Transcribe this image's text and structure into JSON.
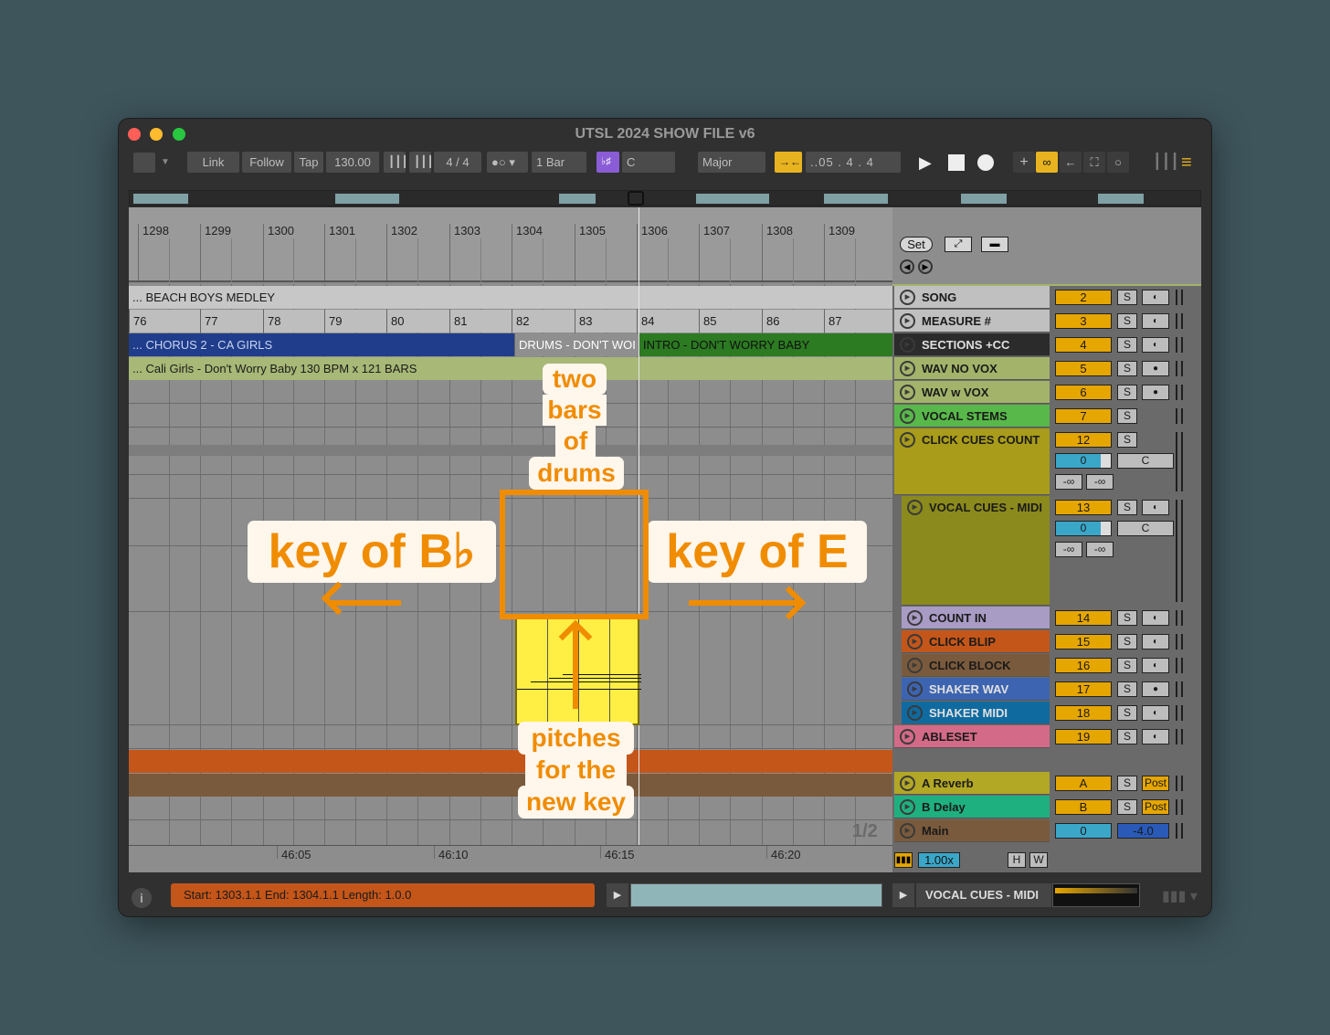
{
  "window": {
    "title": "UTSL 2024 SHOW FILE v6"
  },
  "toolbar": {
    "link": "Link",
    "follow": "Follow",
    "tap": "Tap",
    "tempo": "130.00",
    "signature": "4 / 4",
    "quantize": "1 Bar",
    "key_root": "C",
    "scale": "Major",
    "position": "..05 .   4 .   4"
  },
  "ruler": {
    "bars": [
      "1298",
      "1299",
      "1300",
      "1301",
      "1302",
      "1303",
      "1304",
      "1305",
      "1306",
      "1307",
      "1308",
      "1309"
    ]
  },
  "lanes": {
    "song": "... BEACH BOYS MEDLEY",
    "measures": [
      "76",
      "77",
      "78",
      "79",
      "80",
      "81",
      "82",
      "83",
      "84",
      "85",
      "86",
      "87"
    ],
    "section_a": "... CHORUS 2 - CA GIRLS",
    "section_b": "DRUMS - DON'T WOI",
    "section_c": "INTRO - DON'T WORRY BABY",
    "wav": "... Cali Girls - Don't Worry Baby 130 BPM x 121 BARS"
  },
  "session": {
    "set": "Set",
    "page": "1/2"
  },
  "tracks": [
    {
      "name": "SONG",
      "num": "2",
      "color": "#c0c0c0"
    },
    {
      "name": "MEASURE #",
      "num": "3",
      "color": "#c0c0c0"
    },
    {
      "name": "SECTIONS +CC",
      "num": "4",
      "color": "#2b2b2b"
    },
    {
      "name": "WAV NO VOX",
      "num": "5",
      "color": "#a3b36a"
    },
    {
      "name": "WAV w VOX",
      "num": "6",
      "color": "#a3b36a"
    },
    {
      "name": "VOCAL STEMS",
      "num": "7",
      "color": "#58b84a"
    },
    {
      "name": "CLICK CUES COUNT",
      "num": "12",
      "color": "#a89c1a"
    },
    {
      "name": "VOCAL CUES - MIDI",
      "num": "13",
      "color": "#8b8a1c"
    },
    {
      "name": "COUNT IN",
      "num": "14",
      "color": "#a89bc4"
    },
    {
      "name": "CLICK BLIP",
      "num": "15",
      "color": "#c4561a"
    },
    {
      "name": "CLICK BLOCK",
      "num": "16",
      "color": "#7a5a3c"
    },
    {
      "name": "SHAKER WAV",
      "num": "17",
      "color": "#3d64b0"
    },
    {
      "name": "SHAKER MIDI",
      "num": "18",
      "color": "#0f6aa0"
    },
    {
      "name": "ABLESET",
      "num": "19",
      "color": "#d36a87"
    },
    {
      "name": "A Reverb",
      "num": "A",
      "color": "#b3a726"
    },
    {
      "name": "B Delay",
      "num": "B",
      "color": "#1fb07f"
    },
    {
      "name": "Main",
      "num": "0",
      "color": "#7a5a3c"
    }
  ],
  "track_controls": {
    "solo": "S",
    "post": "Post",
    "vol": "0",
    "pan": "C",
    "neg_inf": "-∞",
    "main_vol": "-4.0"
  },
  "time_ruler": [
    "46:05",
    "46:10",
    "46:15",
    "46:20"
  ],
  "zoom": "1.00x",
  "hw": {
    "h": "H",
    "w": "W"
  },
  "status": {
    "selection": "Start: 1303.1.1  End: 1304.1.1  Length: 1.0.0",
    "track": "VOCAL CUES - MIDI"
  },
  "annotations": {
    "left_key": "key of B♭",
    "right_key": "key of E",
    "top": [
      "two",
      "bars",
      "of",
      "drums"
    ],
    "bottom": [
      "pitches",
      "for the",
      "new key"
    ]
  },
  "colors": {
    "accent": "#f08c00",
    "clip_yellow": "#ffee44"
  }
}
